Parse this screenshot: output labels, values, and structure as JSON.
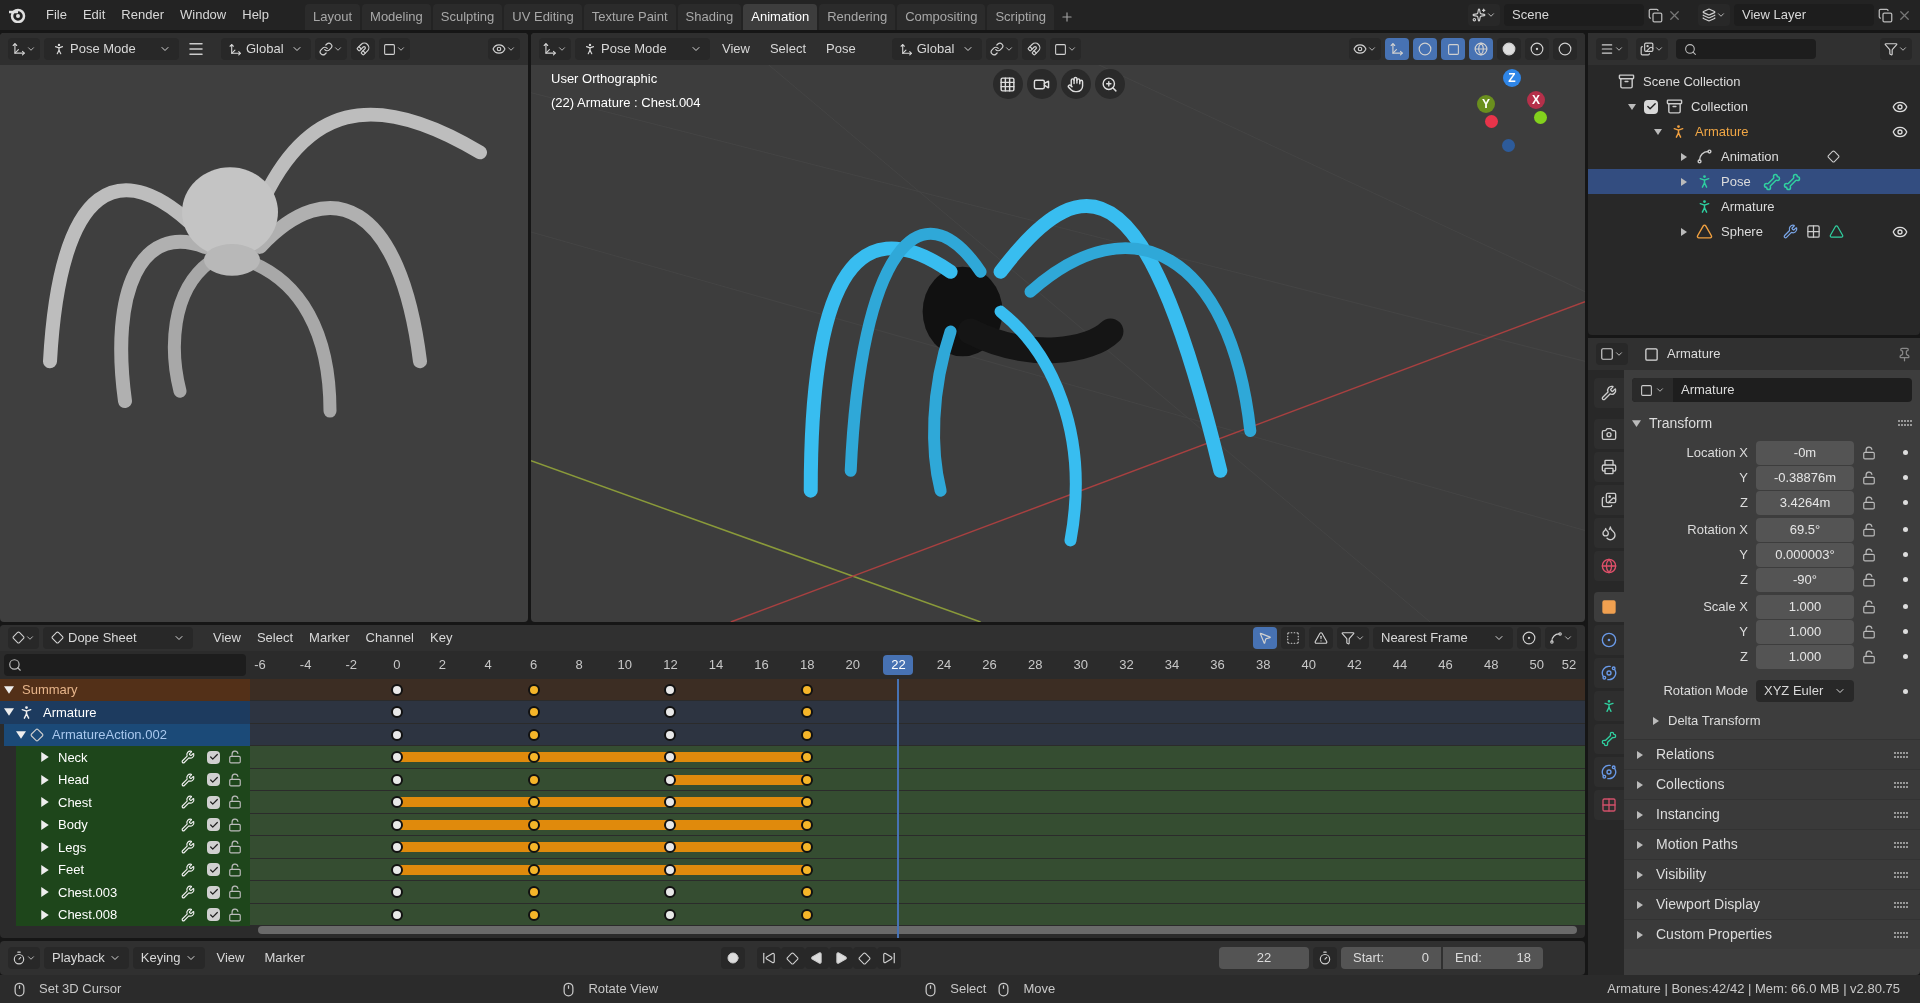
{
  "topbar": {
    "menus": [
      "File",
      "Edit",
      "Render",
      "Window",
      "Help"
    ],
    "workspaces": [
      {
        "label": "Layout",
        "selected": false
      },
      {
        "label": "Modeling",
        "selected": false
      },
      {
        "label": "Sculpting",
        "selected": false
      },
      {
        "label": "UV Editing",
        "selected": false
      },
      {
        "label": "Texture Paint",
        "selected": false
      },
      {
        "label": "Shading",
        "selected": false
      },
      {
        "label": "Animation",
        "selected": true
      },
      {
        "label": "Rendering",
        "selected": false
      },
      {
        "label": "Compositing",
        "selected": false
      },
      {
        "label": "Scripting",
        "selected": false
      }
    ],
    "scene": "Scene",
    "view_layer": "View Layer"
  },
  "left_viewport": {
    "mode": "Pose Mode",
    "orientation": "Global"
  },
  "main_viewport": {
    "mode": "Pose Mode",
    "menus": [
      "View",
      "Select",
      "Pose"
    ],
    "orientation": "Global",
    "view_name": "User Orthographic",
    "object_info": "(22) Armature : Chest.004",
    "gizmo_axes": [
      {
        "label": "Z",
        "color": "#2f86e8"
      },
      {
        "label": "Y",
        "color": "#6a8f1e"
      },
      {
        "label": "X",
        "color": "#b5304a"
      }
    ]
  },
  "outliner": {
    "items": [
      {
        "label": "Scene Collection",
        "kind": "scene",
        "selected": false,
        "children": [
          {
            "label": "Collection",
            "kind": "collection",
            "selected": false,
            "expanded": true,
            "checked": true,
            "visible": true,
            "children": [
              {
                "label": "Armature",
                "kind": "armature",
                "selected": false,
                "expanded": true,
                "active": true,
                "visible": true,
                "children": [
                  {
                    "label": "Animation",
                    "kind": "animation",
                    "selected": false,
                    "expanded": false
                  },
                  {
                    "label": "Pose",
                    "kind": "pose",
                    "selected": true,
                    "expanded": false
                  },
                  {
                    "label": "Armature",
                    "kind": "armature-data",
                    "selected": false
                  },
                  {
                    "label": "Sphere",
                    "kind": "mesh",
                    "selected": false,
                    "expanded": false,
                    "visible": true
                  }
                ]
              }
            ]
          }
        ]
      }
    ]
  },
  "properties": {
    "header": "Armature",
    "object_name": "Armature",
    "tabs": [
      {
        "kind": "tool",
        "selected": false
      },
      {
        "kind": "render",
        "selected": false
      },
      {
        "kind": "output",
        "selected": false
      },
      {
        "kind": "view-layer",
        "selected": false
      },
      {
        "kind": "scene",
        "selected": false
      },
      {
        "kind": "world",
        "selected": false
      },
      {
        "kind": "object",
        "selected": true
      },
      {
        "kind": "physics",
        "selected": false
      },
      {
        "kind": "constraints",
        "selected": false
      },
      {
        "kind": "data",
        "selected": false
      },
      {
        "kind": "bone",
        "selected": false
      },
      {
        "kind": "bone-constraints",
        "selected": false
      },
      {
        "kind": "texture",
        "selected": false
      }
    ],
    "transform": {
      "title": "Transform",
      "expanded": true,
      "rows": [
        {
          "label": "Location X",
          "value": "-0m"
        },
        {
          "label": "Y",
          "value": "-0.38876m"
        },
        {
          "label": "Z",
          "value": "3.4264m"
        },
        {
          "label": "Rotation X",
          "value": "69.5°"
        },
        {
          "label": "Y",
          "value": "0.000003°"
        },
        {
          "label": "Z",
          "value": "-90°"
        },
        {
          "label": "Scale X",
          "value": "1.000"
        },
        {
          "label": "Y",
          "value": "1.000"
        },
        {
          "label": "Z",
          "value": "1.000"
        }
      ],
      "rotation_mode_label": "Rotation Mode",
      "rotation_mode": "XYZ Euler",
      "subpanel": "Delta Transform"
    },
    "panels": [
      "Relations",
      "Collections",
      "Instancing",
      "Motion Paths",
      "Visibility",
      "Viewport Display",
      "Custom Properties"
    ]
  },
  "dope_sheet": {
    "editor": "Dope Sheet",
    "menus": [
      "View",
      "Select",
      "Marker",
      "Channel",
      "Key"
    ],
    "only_selected": true,
    "snap": "Nearest Frame",
    "ruler": [
      {
        "label": "-6",
        "selected": false
      },
      {
        "label": "-4",
        "selected": false
      },
      {
        "label": "-2",
        "selected": false
      },
      {
        "label": "0",
        "selected": false
      },
      {
        "label": "2",
        "selected": false
      },
      {
        "label": "4",
        "selected": false
      },
      {
        "label": "6",
        "selected": false
      },
      {
        "label": "8",
        "selected": false
      },
      {
        "label": "10",
        "selected": false
      },
      {
        "label": "12",
        "selected": false
      },
      {
        "label": "14",
        "selected": false
      },
      {
        "label": "16",
        "selected": false
      },
      {
        "label": "18",
        "selected": false
      },
      {
        "label": "20",
        "selected": false
      },
      {
        "label": "22",
        "selected": true
      },
      {
        "label": "24",
        "selected": false
      },
      {
        "label": "26",
        "selected": false
      },
      {
        "label": "28",
        "selected": false
      },
      {
        "label": "30",
        "selected": false
      },
      {
        "label": "32",
        "selected": false
      },
      {
        "label": "34",
        "selected": false
      },
      {
        "label": "36",
        "selected": false
      },
      {
        "label": "38",
        "selected": false
      },
      {
        "label": "40",
        "selected": false
      },
      {
        "label": "42",
        "selected": false
      },
      {
        "label": "44",
        "selected": false
      },
      {
        "label": "46",
        "selected": false
      },
      {
        "label": "48",
        "selected": false
      },
      {
        "label": "50",
        "selected": false
      },
      {
        "label": "52",
        "selected": false
      }
    ],
    "channels": [
      {
        "name": "Summary",
        "kind": "summary",
        "expanded": true,
        "keys": [
          {
            "selected": false,
            "hold": false
          },
          {
            "selected": true,
            "hold": false
          },
          {
            "selected": false,
            "hold": false
          },
          {
            "selected": true,
            "hold": false
          }
        ]
      },
      {
        "name": "Armature",
        "kind": "object",
        "expanded": true,
        "keys": [
          {
            "selected": false,
            "hold": false
          },
          {
            "selected": true,
            "hold": false
          },
          {
            "selected": false,
            "hold": false
          },
          {
            "selected": true,
            "hold": false
          }
        ]
      },
      {
        "name": "ArmatureAction.002",
        "kind": "action",
        "expanded": true,
        "keys": [
          {
            "selected": false,
            "hold": false
          },
          {
            "selected": true,
            "hold": false
          },
          {
            "selected": false,
            "hold": false
          },
          {
            "selected": true,
            "hold": false
          }
        ]
      },
      {
        "name": "Neck",
        "kind": "group",
        "expanded": false,
        "enabled": true,
        "keys": [
          {
            "selected": false,
            "hold": true
          },
          {
            "selected": true,
            "hold": true
          },
          {
            "selected": false,
            "hold": true
          },
          {
            "selected": true,
            "hold": false
          }
        ]
      },
      {
        "name": "Head",
        "kind": "group",
        "expanded": false,
        "enabled": true,
        "keys": [
          {
            "selected": false,
            "hold": false
          },
          {
            "selected": true,
            "hold": false
          },
          {
            "selected": false,
            "hold": true
          },
          {
            "selected": true,
            "hold": false
          }
        ]
      },
      {
        "name": "Chest",
        "kind": "group",
        "expanded": false,
        "enabled": true,
        "keys": [
          {
            "selected": false,
            "hold": true
          },
          {
            "selected": true,
            "hold": true
          },
          {
            "selected": false,
            "hold": true
          },
          {
            "selected": true,
            "hold": false
          }
        ]
      },
      {
        "name": "Body",
        "kind": "group",
        "expanded": false,
        "enabled": true,
        "keys": [
          {
            "selected": false,
            "hold": true
          },
          {
            "selected": true,
            "hold": true
          },
          {
            "selected": false,
            "hold": true
          },
          {
            "selected": true,
            "hold": false
          }
        ]
      },
      {
        "name": "Legs",
        "kind": "group",
        "expanded": false,
        "enabled": true,
        "keys": [
          {
            "selected": false,
            "hold": true
          },
          {
            "selected": true,
            "hold": true
          },
          {
            "selected": false,
            "hold": true
          },
          {
            "selected": true,
            "hold": false
          }
        ]
      },
      {
        "name": "Feet",
        "kind": "group",
        "expanded": false,
        "enabled": true,
        "keys": [
          {
            "selected": false,
            "hold": true
          },
          {
            "selected": true,
            "hold": true
          },
          {
            "selected": false,
            "hold": true
          },
          {
            "selected": true,
            "hold": false
          }
        ]
      },
      {
        "name": "Chest.003",
        "kind": "group",
        "expanded": false,
        "enabled": true,
        "keys": [
          {
            "selected": false,
            "hold": false
          },
          {
            "selected": true,
            "hold": false
          },
          {
            "selected": false,
            "hold": false
          },
          {
            "selected": true,
            "hold": false
          }
        ]
      },
      {
        "name": "Chest.008",
        "kind": "group",
        "expanded": false,
        "enabled": true,
        "keys": [
          {
            "selected": false,
            "hold": false
          },
          {
            "selected": true,
            "hold": false
          },
          {
            "selected": false,
            "hold": false
          },
          {
            "selected": true,
            "hold": false
          }
        ]
      }
    ]
  },
  "timeline": {
    "menus": [
      "Playback",
      "Keying",
      "View",
      "Marker"
    ],
    "current_frame": "22",
    "start_label": "Start:",
    "start": "0",
    "end_label": "End:",
    "end": "18"
  },
  "status_bar": {
    "hints": [
      "Set 3D Cursor",
      "Rotate View",
      "Select",
      "Move"
    ],
    "info": "Armature | Bones:42/42 | Mem: 66.0 MB | v2.80.75"
  }
}
